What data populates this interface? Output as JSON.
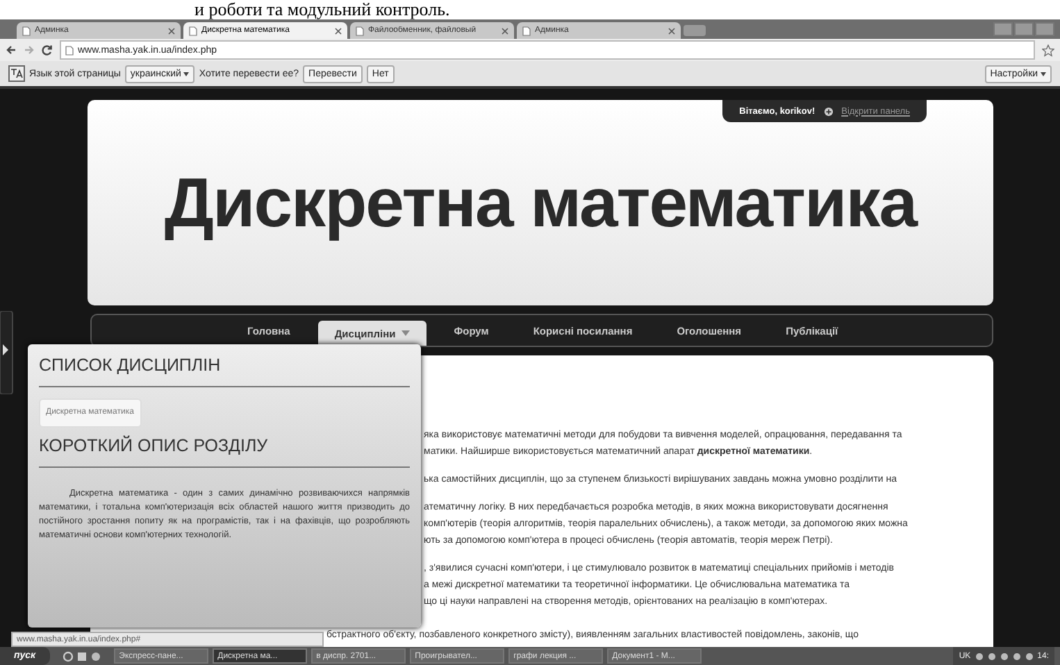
{
  "caption": "и роботи та модульний контроль.",
  "browser": {
    "tabs": [
      {
        "label": "Админка",
        "selected": false
      },
      {
        "label": "Дискретна математика",
        "selected": true
      },
      {
        "label": "Файлообменник, файловый",
        "selected": false
      },
      {
        "label": "Админка",
        "selected": false
      }
    ],
    "address": "www.masha.yak.in.ua/index.php",
    "translate_bar": {
      "prompt": "Язык этой страницы",
      "language": "украинский",
      "question": "Хотите перевести ее?",
      "buttons": [
        "Перевести",
        "Нет"
      ],
      "settings": "Настройки"
    }
  },
  "site": {
    "welcome": "Вітаємо, korikov!",
    "open_panel": "Відкрити панель",
    "title": "Дискретна математика",
    "nav": [
      {
        "label": "Головна",
        "selected": false,
        "dropdown": false
      },
      {
        "label": "Дисципліни",
        "selected": true,
        "dropdown": true
      },
      {
        "label": "Форум",
        "selected": false,
        "dropdown": false
      },
      {
        "label": "Корисні посилання",
        "selected": false,
        "dropdown": false
      },
      {
        "label": "Оголошення",
        "selected": false,
        "dropdown": false
      },
      {
        "label": "Публікації",
        "selected": false,
        "dropdown": false
      }
    ],
    "dropdown": {
      "list_heading": "СПИСОК ДИСЦИПЛІН",
      "items": [
        "Дискретна математика"
      ],
      "description_heading": "КОРОТКИЙ ОПИС РОЗДІЛУ",
      "description": "Дискретна математика - один з самих динамічно розвиваючихся напрямків математики, і тотальна комп'ютеризація всіх областей нашого життя призводить до постійного зростання попиту як на програмістів, так і на фахівців, що розробляють математичні основи комп'ютерних технологій."
    },
    "content": [
      [
        "яка використовує математичні методи для побудови та вивчення моделей, опрацювання, передавання та",
        "матики. Найширше використовується математичний апарат **дискретної математики**."
      ],
      [
        "ька самостійних дисциплін, що за ступенем близькості вирішуваних завдань можна умовно розділити на"
      ],
      [
        "атематичну логіку. В них передбачається розробка методів, в яких можна використовувати досягнення",
        "комп'ютерів (теорія алгоритмів, теорія паралельних обчислень), а також методи, за допомогою яких можна",
        "ють за допомогою комп'ютера в процесі обчислень (теорія автоматів, теорія мереж Петрі)."
      ],
      [
        ", з'явилися сучасні комп'ютери, і це стимулювало розвиток в математиці спеціальних прийомів і методів",
        "а межі дискретної математики та теоретичної інформатики. Це обчислювальна математика та",
        "що ці науки направлені на створення методів, орієнтованих на реалізацію в комп'ютерах."
      ],
      [
        "бстрактного об'єкту, позбавленого конкретного змісту), виявленням загальних властивостей повідомлень, законів, що"
      ]
    ],
    "status_url": "www.masha.yak.in.ua/index.php#"
  },
  "taskbar": {
    "start": "пуск",
    "items": [
      {
        "label": "Экспресс-пане...",
        "selected": false
      },
      {
        "label": "Дискретна ма...",
        "selected": true
      },
      {
        "label": "в диспр. 2701...",
        "selected": false
      },
      {
        "label": "Проигрывател...",
        "selected": false
      },
      {
        "label": "графи лекция ...",
        "selected": false
      },
      {
        "label": "Документ1 - M...",
        "selected": false
      }
    ],
    "language": "UK",
    "clock": "14:"
  }
}
